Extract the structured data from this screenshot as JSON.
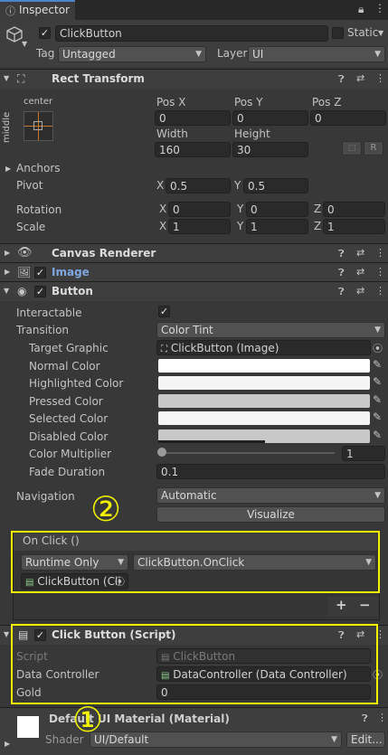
{
  "tab": {
    "title": "Inspector"
  },
  "object": {
    "name": "ClickButton",
    "static_label": "Static",
    "tag_label": "Tag",
    "tag_value": "Untagged",
    "layer_label": "Layer",
    "layer_value": "UI"
  },
  "rect_transform": {
    "title": "Rect Transform",
    "anchor_h": "center",
    "anchor_v": "middle",
    "pos_x_label": "Pos X",
    "pos_y_label": "Pos Y",
    "pos_z_label": "Pos Z",
    "pos_x": "0",
    "pos_y": "0",
    "pos_z": "0",
    "width_label": "Width",
    "height_label": "Height",
    "width": "160",
    "height": "30",
    "r_label": "R",
    "anchors_label": "Anchors",
    "pivot_label": "Pivot",
    "pivot_x": "0.5",
    "pivot_y": "0.5",
    "rotation_label": "Rotation",
    "rot_x": "0",
    "rot_y": "0",
    "rot_z": "0",
    "scale_label": "Scale",
    "scale_x": "1",
    "scale_y": "1",
    "scale_z": "1",
    "x": "X",
    "y": "Y",
    "z": "Z"
  },
  "canvas_renderer": {
    "title": "Canvas Renderer"
  },
  "image": {
    "title": "Image"
  },
  "button": {
    "title": "Button",
    "interactable_label": "Interactable",
    "transition_label": "Transition",
    "transition_value": "Color Tint",
    "target_graphic_label": "Target Graphic",
    "target_graphic_value": "ClickButton (Image)",
    "normal_color_label": "Normal Color",
    "highlighted_color_label": "Highlighted Color",
    "pressed_color_label": "Pressed Color",
    "selected_color_label": "Selected Color",
    "disabled_color_label": "Disabled Color",
    "color_multiplier_label": "Color Multiplier",
    "color_multiplier_value": "1",
    "color_multiplier_fraction": 0,
    "fade_duration_label": "Fade Duration",
    "fade_duration_value": "0.1",
    "navigation_label": "Navigation",
    "navigation_value": "Automatic",
    "visualize_label": "Visualize",
    "on_click_label": "On Click ()",
    "runtime_value": "Runtime Only",
    "function_value": "ClickButton.OnClick",
    "object_value": "ClickButton (Cli",
    "plus": "+",
    "minus": "−",
    "colors": {
      "normal": "#ffffff",
      "highlighted": "#f5f5f5",
      "pressed": "#c8c8c8",
      "selected": "#f5f5f5",
      "disabled": "#c8c8c8"
    }
  },
  "script_component": {
    "title": "Click Button (Script)",
    "script_label": "Script",
    "script_value": "ClickButton",
    "data_controller_label": "Data Controller",
    "data_controller_value": "DataController (Data Controller)",
    "gold_label": "Gold",
    "gold_value": "0"
  },
  "material": {
    "title": "Default UI Material (Material)",
    "shader_label": "Shader",
    "shader_value": "UI/Default",
    "edit_label": "Edit..."
  },
  "annotations": {
    "circle_2": "②",
    "circle_1": "①",
    "highlight_color": "#f3f300"
  }
}
